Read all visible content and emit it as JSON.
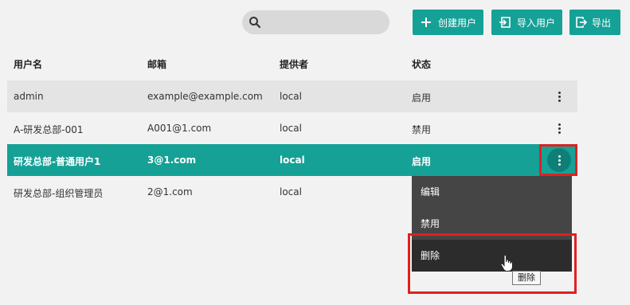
{
  "toolbar": {
    "search_placeholder": "",
    "create_label": "创建用户",
    "import_label": "导入用户",
    "export_label": "导出"
  },
  "table": {
    "headers": [
      "用户名",
      "邮箱",
      "提供者",
      "状态"
    ],
    "rows": [
      {
        "username": "admin",
        "email": "example@example.com",
        "provider": "local",
        "status": "启用"
      },
      {
        "username": "A-研发总部-001",
        "email": "A001@1.com",
        "provider": "local",
        "status": "禁用"
      },
      {
        "username": "研发总部-普通用户1",
        "email": "3@1.com",
        "provider": "local",
        "status": "启用"
      },
      {
        "username": "研发总部-组织管理员",
        "email": "2@1.com",
        "provider": "local",
        "status": ""
      }
    ]
  },
  "menu": {
    "items": [
      "编辑",
      "禁用",
      "删除"
    ]
  },
  "tooltip": "删除",
  "colors": {
    "accent": "#15a196",
    "highlight": "#e02020",
    "menu_bg": "#454545"
  }
}
